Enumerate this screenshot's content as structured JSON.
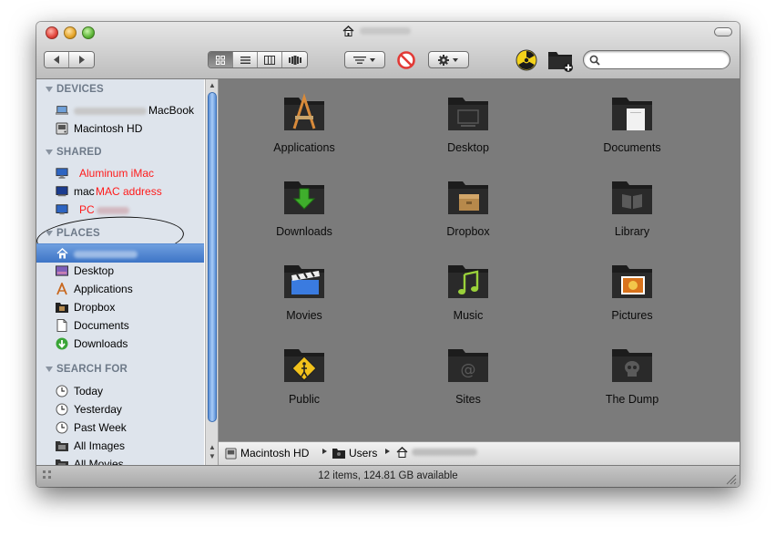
{
  "window": {
    "status": "12 items, 124.81 GB available"
  },
  "sidebar": {
    "devices": {
      "header": "DEVICES",
      "items": [
        {
          "label": "MacBook"
        },
        {
          "label": "Macintosh HD"
        }
      ]
    },
    "shared": {
      "header": "SHARED",
      "items": [
        {
          "label": "Aluminum iMac"
        },
        {
          "label_prefix": "mac",
          "label": "MAC address"
        },
        {
          "label": "PC"
        }
      ]
    },
    "places": {
      "header": "PLACES",
      "items": [
        {
          "label": "Desktop"
        },
        {
          "label": "Applications"
        },
        {
          "label": "Dropbox"
        },
        {
          "label": "Documents"
        },
        {
          "label": "Downloads"
        }
      ]
    },
    "search_for": {
      "header": "SEARCH FOR",
      "items": [
        {
          "label": "Today"
        },
        {
          "label": "Yesterday"
        },
        {
          "label": "Past Week"
        },
        {
          "label": "All Images"
        },
        {
          "label": "All Movies"
        }
      ]
    }
  },
  "folders": [
    {
      "label": "Applications",
      "icon": "applications-folder-icon"
    },
    {
      "label": "Desktop",
      "icon": "desktop-folder-icon"
    },
    {
      "label": "Documents",
      "icon": "documents-folder-icon"
    },
    {
      "label": "Downloads",
      "icon": "downloads-folder-icon"
    },
    {
      "label": "Dropbox",
      "icon": "dropbox-folder-icon"
    },
    {
      "label": "Library",
      "icon": "library-folder-icon"
    },
    {
      "label": "Movies",
      "icon": "movies-folder-icon"
    },
    {
      "label": "Music",
      "icon": "music-folder-icon"
    },
    {
      "label": "Pictures",
      "icon": "pictures-folder-icon"
    },
    {
      "label": "Public",
      "icon": "public-folder-icon"
    },
    {
      "label": "Sites",
      "icon": "sites-folder-icon"
    },
    {
      "label": "The Dump",
      "icon": "skull-folder-icon"
    }
  ],
  "pathbar": {
    "items": [
      {
        "label": "Macintosh HD"
      },
      {
        "label": "Users"
      }
    ]
  },
  "colors": {
    "content_bg": "#7b7b7b",
    "sidebar_bg": "#dee4ec",
    "selection": "#3d74c6",
    "annotation_red": "#ff1a1a"
  }
}
